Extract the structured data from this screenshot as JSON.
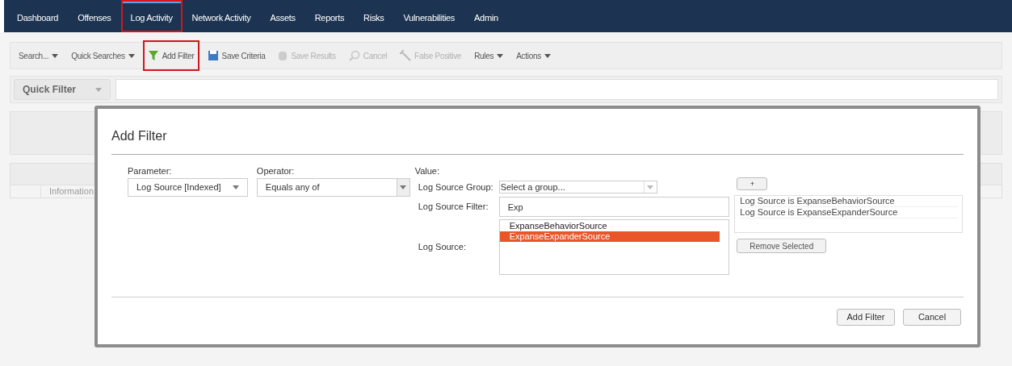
{
  "nav": {
    "tabs": [
      {
        "label": "Dashboard",
        "selected": false,
        "highlighted": false
      },
      {
        "label": "Offenses",
        "selected": false,
        "highlighted": false
      },
      {
        "label": "Log Activity",
        "selected": true,
        "highlighted": true
      },
      {
        "label": "Network Activity",
        "selected": false,
        "highlighted": false
      },
      {
        "label": "Assets",
        "selected": false,
        "highlighted": false
      },
      {
        "label": "Reports",
        "selected": false,
        "highlighted": false
      },
      {
        "label": "Risks",
        "selected": false,
        "highlighted": false
      },
      {
        "label": "Vulnerabilities",
        "selected": false,
        "highlighted": false
      },
      {
        "label": "Admin",
        "selected": false,
        "highlighted": false
      }
    ]
  },
  "toolbar": [
    {
      "label": "Search...",
      "kind": "menu",
      "disabled": false,
      "highlighted": false
    },
    {
      "label": "Quick Searches",
      "kind": "menu",
      "disabled": false,
      "highlighted": false
    },
    {
      "label": "Add Filter",
      "kind": "filter",
      "disabled": false,
      "highlighted": true
    },
    {
      "label": "Save Criteria",
      "kind": "save",
      "disabled": false,
      "highlighted": false
    },
    {
      "label": "Save Results",
      "kind": "database",
      "disabled": true,
      "highlighted": false
    },
    {
      "label": "Cancel",
      "kind": "cancel",
      "disabled": true,
      "highlighted": false
    },
    {
      "label": "False Positive",
      "kind": "wrench",
      "disabled": true,
      "highlighted": false
    },
    {
      "label": "Rules",
      "kind": "menu",
      "disabled": false,
      "highlighted": false
    },
    {
      "label": "Actions",
      "kind": "menu",
      "disabled": false,
      "highlighted": false
    }
  ],
  "quick_filter": {
    "label": "Quick Filter"
  },
  "table": {
    "cell": "Information"
  },
  "dialog": {
    "title": "Add Filter",
    "parameter": {
      "label": "Parameter:",
      "value": "Log Source [Indexed]"
    },
    "operator": {
      "label": "Operator:",
      "value": "Equals any of"
    },
    "value": {
      "label": "Value:",
      "group_label": "Log Source Group:",
      "group_placeholder": "Select a group...",
      "filter_label": "Log Source Filter:",
      "filter_value": "Exp",
      "source_label": "Log Source:",
      "sources": [
        {
          "label": "ExpanseBehaviorSource",
          "selected": false
        },
        {
          "label": "ExpanseExpanderSource",
          "selected": true
        }
      ]
    },
    "add_button": "+",
    "selected_filters": [
      "Log Source is ExpanseBehaviorSource",
      "Log Source is ExpanseExpanderSource"
    ],
    "remove_button": "Remove Selected",
    "buttons": [
      "Add Filter",
      "Cancel"
    ]
  }
}
